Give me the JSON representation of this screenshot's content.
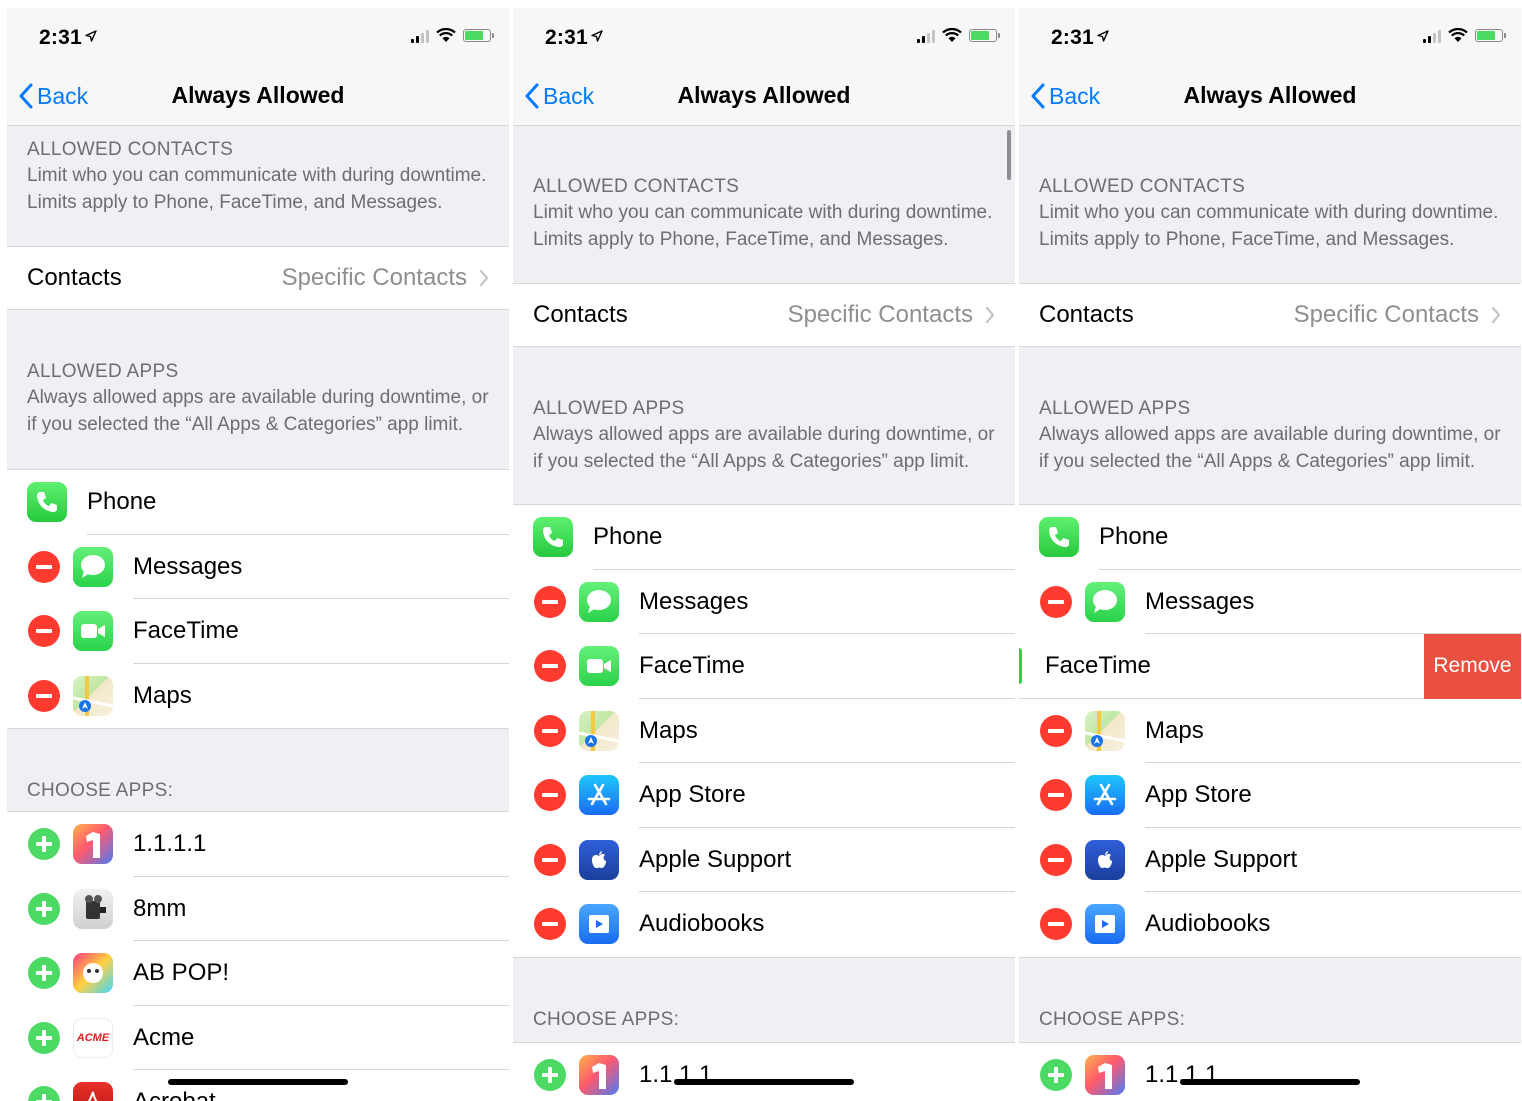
{
  "status": {
    "time": "2:31"
  },
  "nav": {
    "back_label": "Back",
    "title": "Always Allowed"
  },
  "contacts_section": {
    "title": "ALLOWED CONTACTS",
    "description": "Limit who you can communicate with during downtime. Limits apply to Phone, FaceTime, and Messages."
  },
  "contacts_cell": {
    "label": "Contacts",
    "value": "Specific Contacts"
  },
  "apps_section": {
    "title": "ALLOWED APPS",
    "description": "Always allowed apps are available during downtime, or if you selected the “All Apps & Categories” app limit."
  },
  "choose_section": {
    "title": "CHOOSE APPS:"
  },
  "allowed_apps": [
    "Phone",
    "Messages",
    "FaceTime",
    "Maps",
    "App Store",
    "Apple Support",
    "Audiobooks"
  ],
  "choose_apps": [
    "1.1.1.1",
    "8mm",
    "AB POP!",
    "Acme",
    "Acrobat"
  ],
  "remove_label": "Remove",
  "icon_labels": {
    "acme": "ACME"
  },
  "colors": {
    "accent": "#007aff",
    "destructive": "#ff3b30",
    "add": "#4cd964",
    "remove_action": "#e9503f"
  }
}
